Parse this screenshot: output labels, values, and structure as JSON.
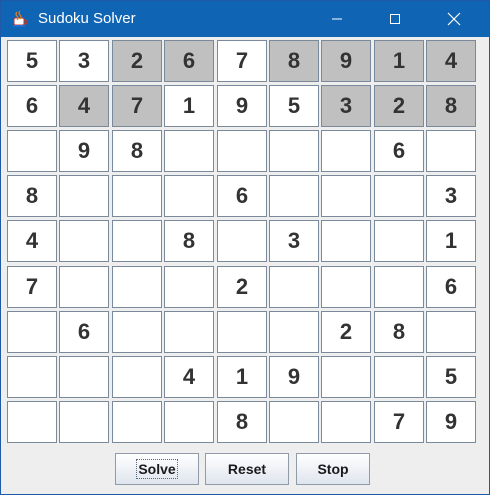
{
  "window": {
    "title": "Sudoku Solver",
    "icon": "java-cup-icon",
    "controls": [
      "minimize-icon",
      "maximize-icon",
      "close-icon"
    ]
  },
  "grid": {
    "rows": [
      [
        {
          "v": "5",
          "filled": false
        },
        {
          "v": "3",
          "filled": false
        },
        {
          "v": "2",
          "filled": true
        },
        {
          "v": "6",
          "filled": true
        },
        {
          "v": "7",
          "filled": false
        },
        {
          "v": "8",
          "filled": true
        },
        {
          "v": "9",
          "filled": true
        },
        {
          "v": "1",
          "filled": true
        },
        {
          "v": "4",
          "filled": true
        }
      ],
      [
        {
          "v": "6",
          "filled": false
        },
        {
          "v": "4",
          "filled": true
        },
        {
          "v": "7",
          "filled": true
        },
        {
          "v": "1",
          "filled": false
        },
        {
          "v": "9",
          "filled": false
        },
        {
          "v": "5",
          "filled": false
        },
        {
          "v": "3",
          "filled": true
        },
        {
          "v": "2",
          "filled": true
        },
        {
          "v": "8",
          "filled": true
        }
      ],
      [
        {
          "v": "",
          "filled": false
        },
        {
          "v": "9",
          "filled": false
        },
        {
          "v": "8",
          "filled": false
        },
        {
          "v": "",
          "filled": false
        },
        {
          "v": "",
          "filled": false
        },
        {
          "v": "",
          "filled": false
        },
        {
          "v": "",
          "filled": false
        },
        {
          "v": "6",
          "filled": false
        },
        {
          "v": "",
          "filled": false
        }
      ],
      [
        {
          "v": "8",
          "filled": false
        },
        {
          "v": "",
          "filled": false
        },
        {
          "v": "",
          "filled": false
        },
        {
          "v": "",
          "filled": false
        },
        {
          "v": "6",
          "filled": false
        },
        {
          "v": "",
          "filled": false
        },
        {
          "v": "",
          "filled": false
        },
        {
          "v": "",
          "filled": false
        },
        {
          "v": "3",
          "filled": false
        }
      ],
      [
        {
          "v": "4",
          "filled": false
        },
        {
          "v": "",
          "filled": false
        },
        {
          "v": "",
          "filled": false
        },
        {
          "v": "8",
          "filled": false
        },
        {
          "v": "",
          "filled": false
        },
        {
          "v": "3",
          "filled": false
        },
        {
          "v": "",
          "filled": false
        },
        {
          "v": "",
          "filled": false
        },
        {
          "v": "1",
          "filled": false
        }
      ],
      [
        {
          "v": "7",
          "filled": false
        },
        {
          "v": "",
          "filled": false
        },
        {
          "v": "",
          "filled": false
        },
        {
          "v": "",
          "filled": false
        },
        {
          "v": "2",
          "filled": false
        },
        {
          "v": "",
          "filled": false
        },
        {
          "v": "",
          "filled": false
        },
        {
          "v": "",
          "filled": false
        },
        {
          "v": "6",
          "filled": false
        }
      ],
      [
        {
          "v": "",
          "filled": false
        },
        {
          "v": "6",
          "filled": false
        },
        {
          "v": "",
          "filled": false
        },
        {
          "v": "",
          "filled": false
        },
        {
          "v": "",
          "filled": false
        },
        {
          "v": "",
          "filled": false
        },
        {
          "v": "2",
          "filled": false
        },
        {
          "v": "8",
          "filled": false
        },
        {
          "v": "",
          "filled": false
        }
      ],
      [
        {
          "v": "",
          "filled": false
        },
        {
          "v": "",
          "filled": false
        },
        {
          "v": "",
          "filled": false
        },
        {
          "v": "4",
          "filled": false
        },
        {
          "v": "1",
          "filled": false
        },
        {
          "v": "9",
          "filled": false
        },
        {
          "v": "",
          "filled": false
        },
        {
          "v": "",
          "filled": false
        },
        {
          "v": "5",
          "filled": false
        }
      ],
      [
        {
          "v": "",
          "filled": false
        },
        {
          "v": "",
          "filled": false
        },
        {
          "v": "",
          "filled": false
        },
        {
          "v": "",
          "filled": false
        },
        {
          "v": "8",
          "filled": false
        },
        {
          "v": "",
          "filled": false
        },
        {
          "v": "",
          "filled": false
        },
        {
          "v": "7",
          "filled": false
        },
        {
          "v": "9",
          "filled": false
        }
      ]
    ]
  },
  "buttons": {
    "solve": "Solve",
    "reset": "Reset",
    "stop": "Stop"
  },
  "colors": {
    "titlebar": "#0f64b4",
    "prefilled_cell": "#c0c0c0",
    "empty_cell": "#ffffff"
  }
}
